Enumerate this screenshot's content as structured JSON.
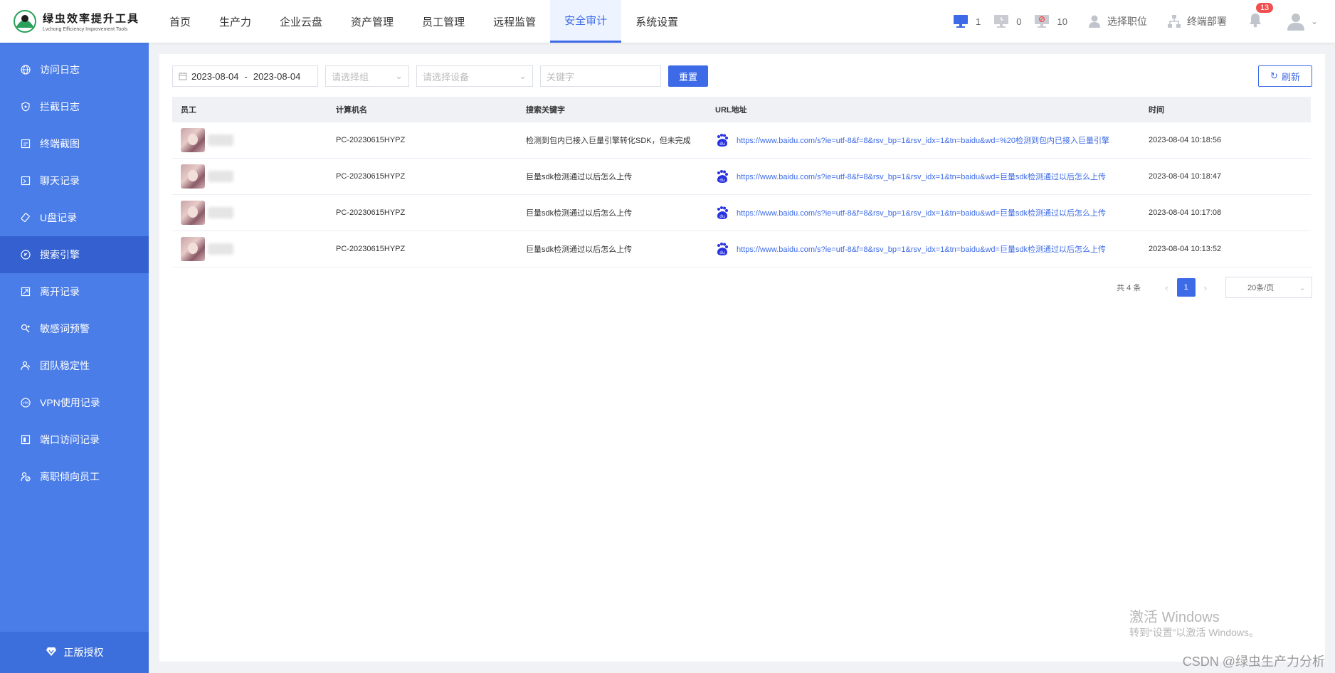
{
  "app": {
    "title": "绿虫效率提升工具",
    "subtitle": "Lvchong Efficiency Improvement Tools"
  },
  "nav": [
    {
      "label": "首页"
    },
    {
      "label": "生产力"
    },
    {
      "label": "企业云盘"
    },
    {
      "label": "资产管理"
    },
    {
      "label": "员工管理"
    },
    {
      "label": "远程监管"
    },
    {
      "label": "安全审计",
      "active": true
    },
    {
      "label": "系统设置"
    }
  ],
  "header": {
    "online_count": "1",
    "idle_count": "0",
    "offline_count": "10",
    "select_position": "选择职位",
    "terminal_deploy": "终端部署",
    "notification_count": "13",
    "colors": {
      "online": "#3d6be8",
      "idle": "#c0c4cc",
      "offline": "#c0c4cc",
      "alert": "#f04f4f"
    }
  },
  "sidebar": {
    "items": [
      {
        "label": "访问日志",
        "icon": "globe-icon"
      },
      {
        "label": "拦截日志",
        "icon": "shield-icon"
      },
      {
        "label": "终端截图",
        "icon": "screenshot-icon"
      },
      {
        "label": "聊天记录",
        "icon": "chat-icon"
      },
      {
        "label": "U盘记录",
        "icon": "usb-icon"
      },
      {
        "label": "搜索引擎",
        "icon": "search-engine-icon",
        "active": true
      },
      {
        "label": "离开记录",
        "icon": "leave-icon"
      },
      {
        "label": "敏感词预警",
        "icon": "sensitive-word-icon"
      },
      {
        "label": "团队稳定性",
        "icon": "team-icon"
      },
      {
        "label": "VPN使用记录",
        "icon": "vpn-icon"
      },
      {
        "label": "端口访问记录",
        "icon": "port-icon"
      },
      {
        "label": "离职倾向员工",
        "icon": "resign-icon"
      }
    ],
    "license": "正版授权"
  },
  "filters": {
    "date_start": "2023-08-04",
    "date_sep": "-",
    "date_end": "2023-08-04",
    "group_placeholder": "请选择组",
    "device_placeholder": "请选择设备",
    "keyword_placeholder": "关键字",
    "reset_label": "重置",
    "refresh_label": "刷新"
  },
  "table": {
    "columns": [
      "员工",
      "计算机名",
      "搜索关键字",
      "URL地址",
      "时间"
    ],
    "rows": [
      {
        "computer": "PC-20230615HYPZ",
        "keyword": "检测到包内已接入巨量引擎转化SDK，但未完成",
        "url": "https://www.baidu.com/s?ie=utf-8&f=8&rsv_bp=1&rsv_idx=1&tn=baidu&wd=%20检测到包内已接入巨量引擎",
        "time": "2023-08-04 10:18:56"
      },
      {
        "computer": "PC-20230615HYPZ",
        "keyword": "巨量sdk检测通过以后怎么上传",
        "url": "https://www.baidu.com/s?ie=utf-8&f=8&rsv_bp=1&rsv_idx=1&tn=baidu&wd=巨量sdk检测通过以后怎么上传",
        "time": "2023-08-04 10:18:47"
      },
      {
        "computer": "PC-20230615HYPZ",
        "keyword": "巨量sdk检测通过以后怎么上传",
        "url": "https://www.baidu.com/s?ie=utf-8&f=8&rsv_bp=1&rsv_idx=1&tn=baidu&wd=巨量sdk检测通过以后怎么上传",
        "time": "2023-08-04 10:17:08"
      },
      {
        "computer": "PC-20230615HYPZ",
        "keyword": "巨量sdk检测通过以后怎么上传",
        "url": "https://www.baidu.com/s?ie=utf-8&f=8&rsv_bp=1&rsv_idx=1&tn=baidu&wd=巨量sdk检测通过以后怎么上传",
        "time": "2023-08-04 10:13:52"
      }
    ]
  },
  "pagination": {
    "total": "共 4 条",
    "current_page": "1",
    "page_size": "20条/页"
  },
  "watermark": {
    "activate_title": "激活 Windows",
    "activate_sub": "转到“设置”以激活 Windows。",
    "source": "CSDN @绿虫生产力分析"
  }
}
